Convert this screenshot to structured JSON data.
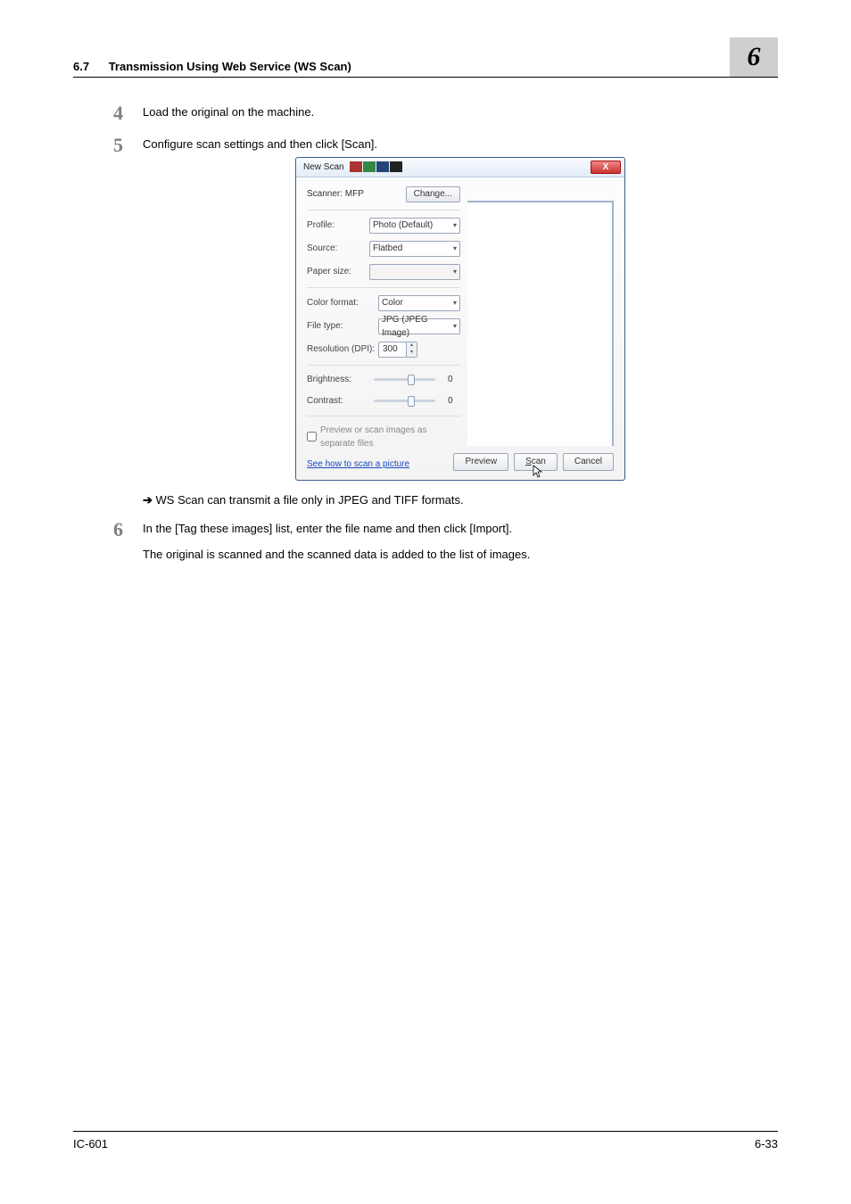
{
  "header": {
    "section_number": "6.7",
    "section_title": "Transmission Using Web Service (WS Scan)",
    "chapter": "6"
  },
  "steps": {
    "s4": {
      "num": "4",
      "text": "Load the original on the machine."
    },
    "s5": {
      "num": "5",
      "text": "Configure scan settings and then click [Scan]."
    },
    "note_arrow": "➔",
    "note5": "WS Scan can transmit a file only in JPEG and TIFF formats.",
    "s6": {
      "num": "6",
      "text": "In the [Tag these images] list, enter the file name and then click [Import].",
      "sub": "The original is scanned and the scanned data is added to the list of images."
    }
  },
  "dialog": {
    "title": "New Scan",
    "close_x": "X",
    "scanner_label": "Scanner: MFP",
    "change_btn": "Change...",
    "profile_label": "Profile:",
    "profile_value": "Photo (Default)",
    "source_label": "Source:",
    "source_value": "Flatbed",
    "paper_label": "Paper size:",
    "paper_value": "",
    "color_label": "Color format:",
    "color_value": "Color",
    "file_label": "File type:",
    "file_value": "JPG (JPEG Image)",
    "res_label": "Resolution (DPI):",
    "res_value": "300",
    "bright_label": "Brightness:",
    "bright_value": "0",
    "contrast_label": "Contrast:",
    "contrast_value": "0",
    "checkbox_label": "Preview or scan images as separate files",
    "link_text": "See how to scan a picture",
    "preview_btn": "Preview",
    "scan_btn_u": "S",
    "scan_btn_rest": "can",
    "cancel_btn": "Cancel"
  },
  "footer": {
    "left": "IC-601",
    "right": "6-33"
  }
}
